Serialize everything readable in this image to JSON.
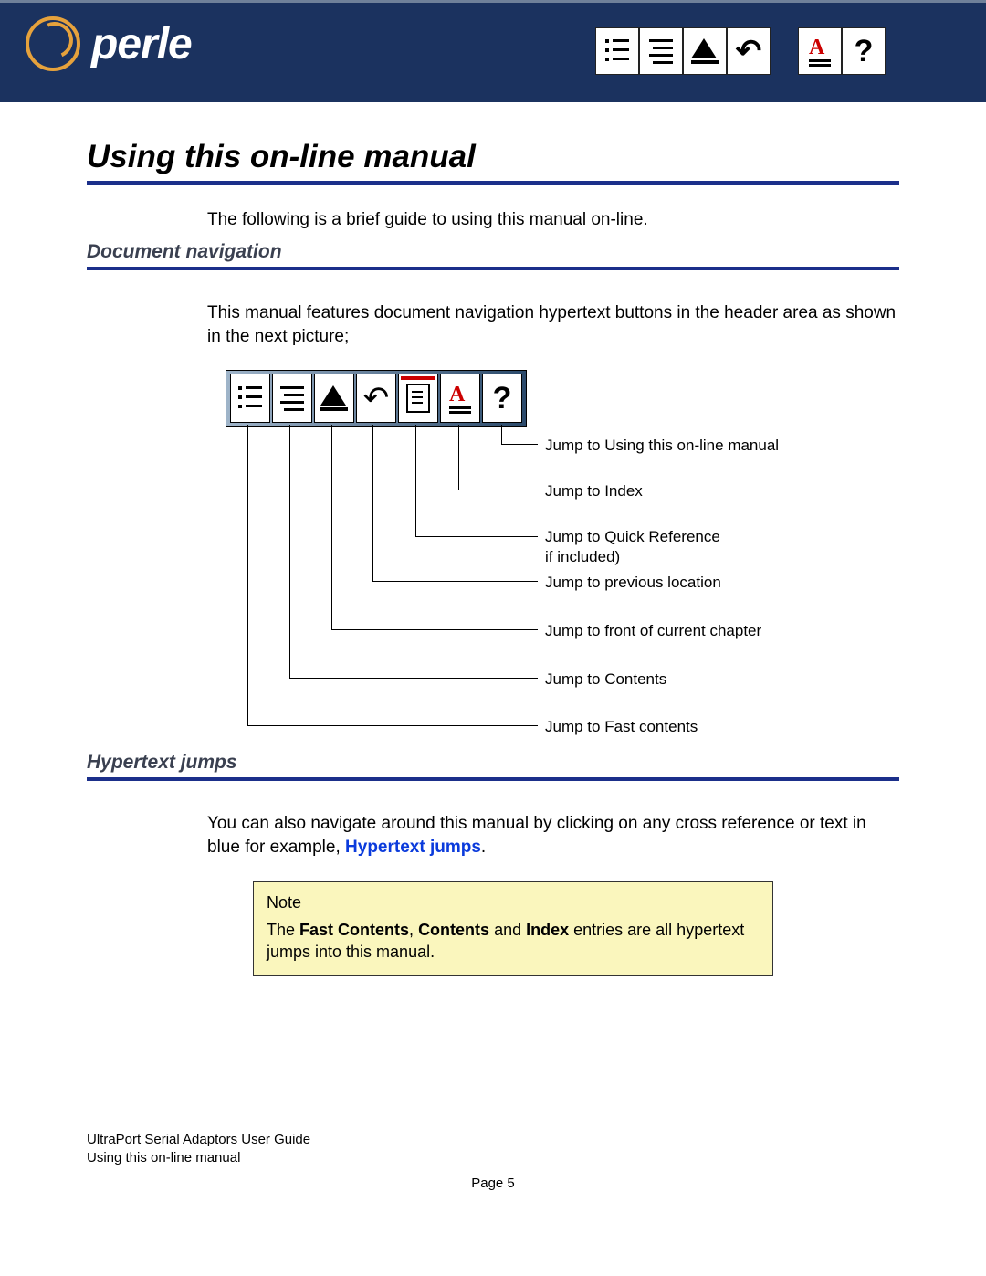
{
  "brand": "perle",
  "main_title": "Using this on-line manual",
  "intro_text": "The following is a brief guide to using this manual on-line.",
  "section1_title": "Document navigation",
  "section1_body": "This manual features document navigation hypertext buttons in the header area as shown in the next picture;",
  "callouts": {
    "c1": "Jump to Using this on-line manual",
    "c2": "Jump to Index",
    "c3_a": "Jump to Quick Reference",
    "c3_b": "if included)",
    "c4": "Jump to previous location",
    "c5": "Jump to front of current chapter",
    "c6": "Jump to Contents",
    "c7": "Jump to Fast contents"
  },
  "section2_title": "Hypertext jumps",
  "section2_body_a": "You can also navigate around this manual by clicking on any cross reference or text in blue for example, ",
  "section2_link": "Hypertext jumps",
  "section2_body_b": ".",
  "note_title": "Note",
  "note_body_a": "The ",
  "note_bold1": "Fast Contents",
  "note_body_b": ", ",
  "note_bold2": "Contents",
  "note_body_c": " and ",
  "note_bold3": "Index",
  "note_body_d": " entries are all hypertext jumps into this manual.",
  "footer_line1": "UltraPort Serial Adaptors User Guide",
  "footer_line2": "Using this on-line manual",
  "page_label": "Page 5"
}
